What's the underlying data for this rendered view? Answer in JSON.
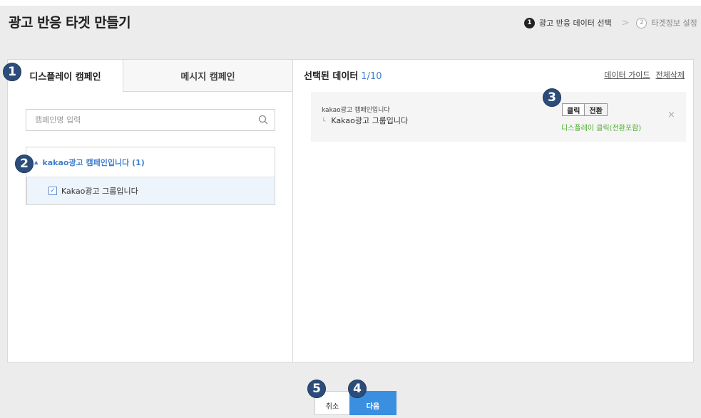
{
  "header": {
    "title": "광고 반응 타겟 만들기",
    "steps": [
      {
        "num": "1",
        "label": "광고 반응 데이터 선택"
      },
      {
        "num": "2",
        "label": "타겟정보 설정"
      }
    ]
  },
  "left": {
    "tabs": [
      {
        "label": "디스플레이 캠페인"
      },
      {
        "label": "메시지 캠페인"
      }
    ],
    "search": {
      "placeholder": "캠페인명 입력",
      "value": ""
    },
    "tree": {
      "campaign_label": "kakao광고 캠페인입니다 (1)",
      "group_label": "Kakao광고 그룹입니다"
    }
  },
  "right": {
    "title": "선택된 데이터",
    "count": "1/10",
    "links": {
      "guide": "데이터 가이드",
      "clear_all": "전체삭제"
    },
    "item": {
      "campaign": "kakao광고 캠페인입니다",
      "group": "Kakao광고 그룹입니다",
      "toggle": [
        "클릭",
        "전환"
      ],
      "description": "디스플레이 클릭(전환포함)"
    }
  },
  "footer": {
    "cancel_label": "취소",
    "next_label": "다음"
  },
  "markers": [
    "1",
    "2",
    "3",
    "4",
    "5"
  ],
  "colors": {
    "accent": "#3b8fe0",
    "link_blue": "#3f7fcf",
    "marker": "#2c4d7a",
    "success_green": "#4caf2c"
  }
}
